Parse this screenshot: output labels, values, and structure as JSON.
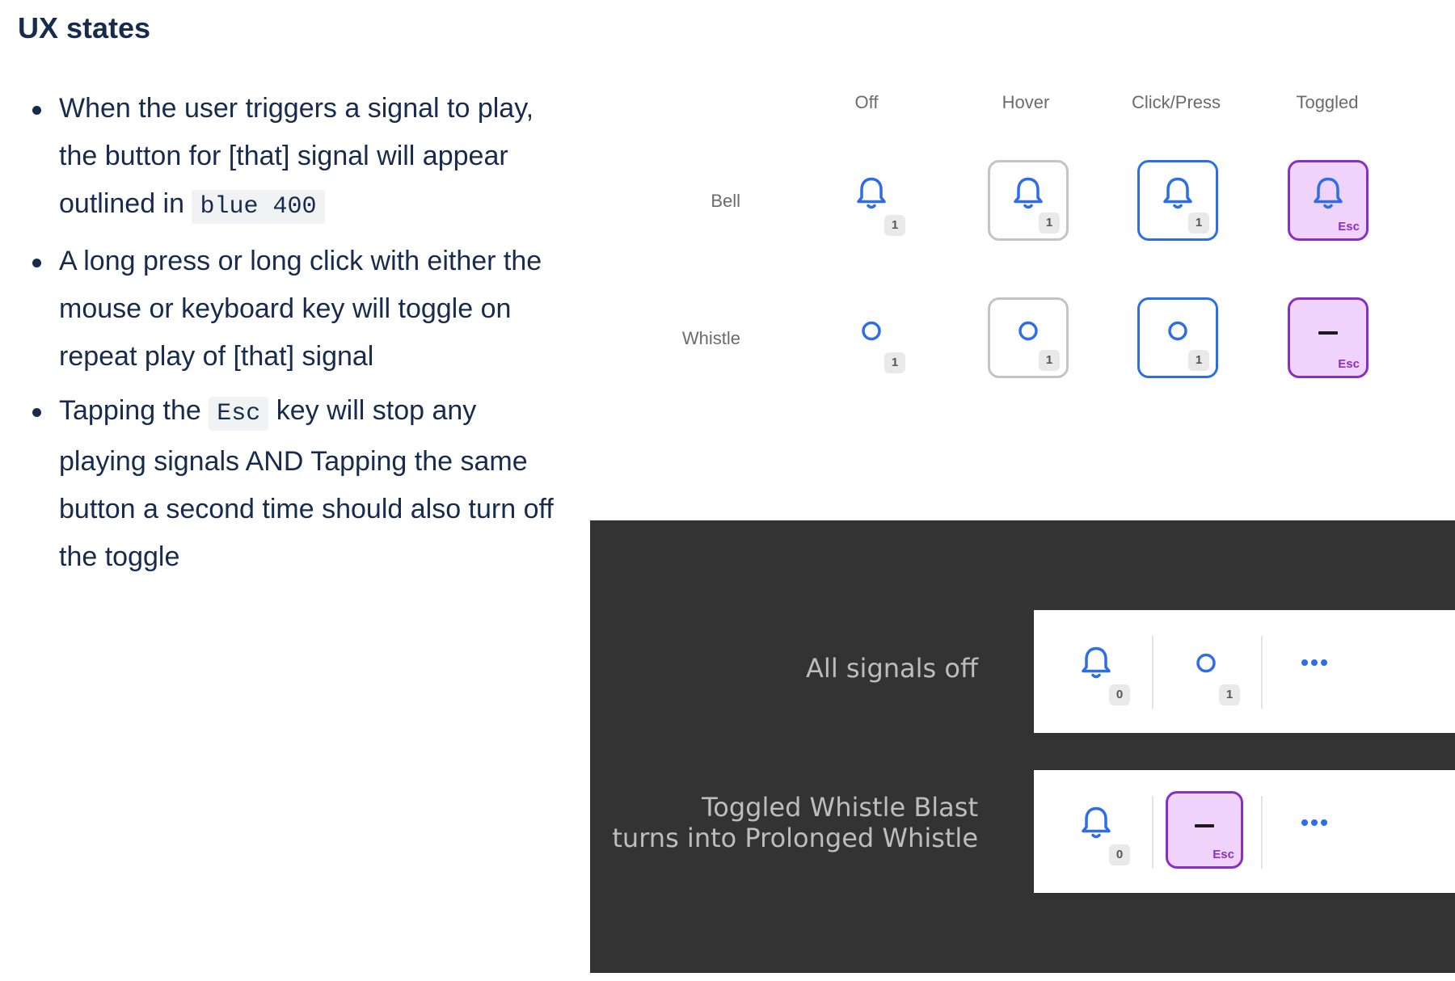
{
  "heading": "UX states",
  "bullets": [
    {
      "before": "When the user triggers a signal to play, the button for [that] signal will appear outlined in ",
      "code": "blue 400",
      "after": ""
    },
    {
      "before": "A long press or long click with either the mouse or keyboard key will toggle on repeat play of [that] signal",
      "code": "",
      "after": ""
    },
    {
      "before": "Tapping the ",
      "code": "Esc",
      "after": " key will stop any playing signals AND Tapping the same button a second time should also turn off the toggle"
    }
  ],
  "states": {
    "columns": [
      "Off",
      "Hover",
      "Click/Press",
      "Toggled"
    ],
    "rows": [
      {
        "label": "Bell",
        "icon": "bell-icon",
        "badge": "1",
        "toggled_label": "Esc"
      },
      {
        "label": "Whistle",
        "icon": "circle-icon",
        "badge": "1",
        "toggled_label": "Esc",
        "toggled_icon": "dash-icon"
      }
    ]
  },
  "examples": [
    {
      "label_lines": [
        "All signals off"
      ],
      "bell_badge": "0",
      "whistle_badge": "1",
      "more": "more-icon"
    },
    {
      "label_lines": [
        "Toggled Whistle Blast",
        "turns into Prolonged Whistle"
      ],
      "bell_badge": "0",
      "toggled_label": "Esc",
      "more": "more-icon"
    }
  ],
  "colors": {
    "blue400": "#2d6ee6",
    "toggled_border": "#8a2fc4",
    "toggled_fill": "#f0d3fa",
    "dark_panel": "#333333"
  }
}
